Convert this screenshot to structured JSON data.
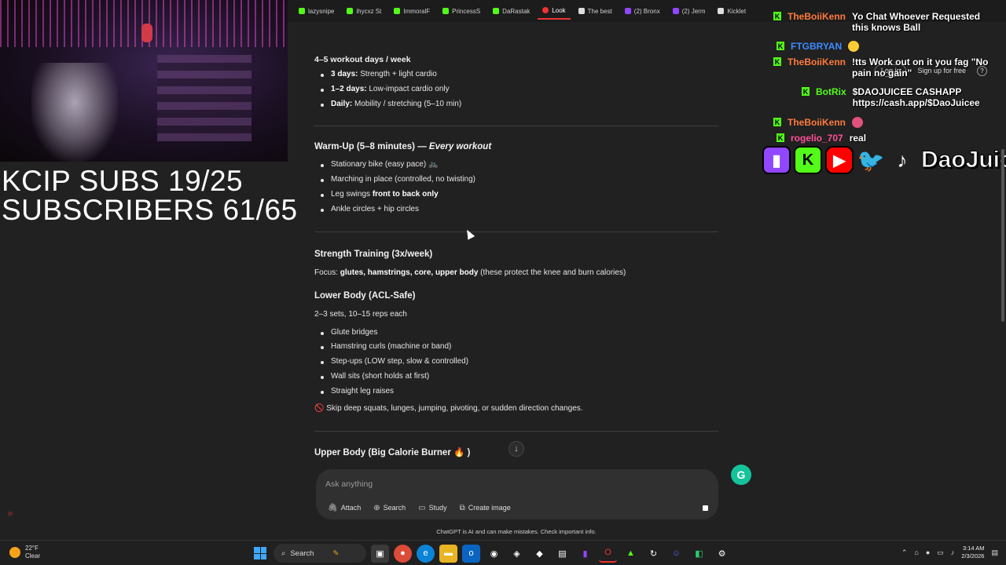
{
  "browser": {
    "tabs": [
      {
        "label": "lazysnipe",
        "color": "green"
      },
      {
        "label": "ihycxz St",
        "color": "green"
      },
      {
        "label": "ImmoralF",
        "color": "green"
      },
      {
        "label": "PrincessS",
        "color": "green"
      },
      {
        "label": "DaRastak",
        "color": "green"
      },
      {
        "label": "Look",
        "color": "red"
      },
      {
        "label": "The best",
        "color": "white"
      },
      {
        "label": "(2) Bronx",
        "color": "purple"
      },
      {
        "label": "(2) Jerm",
        "color": "purple"
      },
      {
        "label": "Kicklet",
        "color": "white"
      }
    ],
    "login_label": "Log in",
    "signup_label": "Sign up for free",
    "help_label": "?"
  },
  "overlay": {
    "subs_line1": "KCIP SUBS 19/25",
    "subs_line2": "SUBSCRIBERS 61/65",
    "brand": "DaoJuice",
    "left_mini": "gk"
  },
  "chat": [
    {
      "user": "TheBoiiKenn",
      "text": "Yo Chat Whoever Requested this knows Ball"
    },
    {
      "user": "FTGBRYAN",
      "text": ""
    },
    {
      "user": "TheBoiiKenn",
      "text": "!tts Work out on it you fag \"No pain no gain\""
    },
    {
      "user": "BotRix",
      "text": "$DAOJUICEE CASHAPP https://cash.app/$DaoJuicee"
    },
    {
      "user": "TheBoiiKenn",
      "text": ""
    },
    {
      "user": "rogelio_707",
      "text": "real"
    }
  ],
  "content": {
    "schedule_title": "4–5 workout days / week",
    "schedule": [
      {
        "bold": "3 days:",
        "rest": " Strength + light cardio"
      },
      {
        "bold": "1–2 days:",
        "rest": " Low-impact cardio only"
      },
      {
        "bold": "Daily:",
        "rest": " Mobility / stretching (5–10 min)"
      }
    ],
    "warmup_title": "Warm-Up (5–8 minutes) — ",
    "warmup_em": "Every workout",
    "warmup_items": [
      {
        "pre": "Stationary bike (easy pace) ",
        "bold": "",
        "post": "🚲"
      },
      {
        "pre": "Marching in place (controlled, no twisting)",
        "bold": "",
        "post": ""
      },
      {
        "pre": "Leg swings ",
        "bold": "front to back only",
        "post": ""
      },
      {
        "pre": "Ankle circles + hip circles",
        "bold": "",
        "post": ""
      }
    ],
    "strength_title": "Strength Training (3x/week)",
    "focus_pre": "Focus: ",
    "focus_bold": "glutes, hamstrings, core, upper body",
    "focus_post": " (these protect the knee and burn calories)",
    "lower_title": "Lower Body (ACL-Safe)",
    "lower_sets": "2–3 sets, 10–15 reps each",
    "lower_items": [
      "Glute bridges",
      "Hamstring curls (machine or band)",
      "Step-ups (LOW step, slow & controlled)",
      "Wall sits (short holds at first)",
      "Straight leg raises"
    ],
    "warning_icon": "🚫",
    "warning": "Skip deep squats, lunges, jumping, pivoting, or sudden direction changes.",
    "upper_title": "Upper Body (Big Calorie Burner 🔥 )"
  },
  "composer": {
    "placeholder": "Ask anything",
    "tools": [
      {
        "icon": "paperclip-icon",
        "glyph": "🖇",
        "label": "Attach"
      },
      {
        "icon": "globe-icon",
        "glyph": "⊕",
        "label": "Search"
      },
      {
        "icon": "book-icon",
        "glyph": "▭",
        "label": "Study"
      },
      {
        "icon": "image-icon",
        "glyph": "⧉",
        "label": "Create image"
      }
    ],
    "disclaimer": "ChatGPT is AI and can make mistakes. Check important info."
  },
  "taskbar": {
    "temperature": "22°F",
    "condition": "Clear",
    "search_label": "Search",
    "time": "3:14 AM",
    "date": "2/3/2026"
  }
}
